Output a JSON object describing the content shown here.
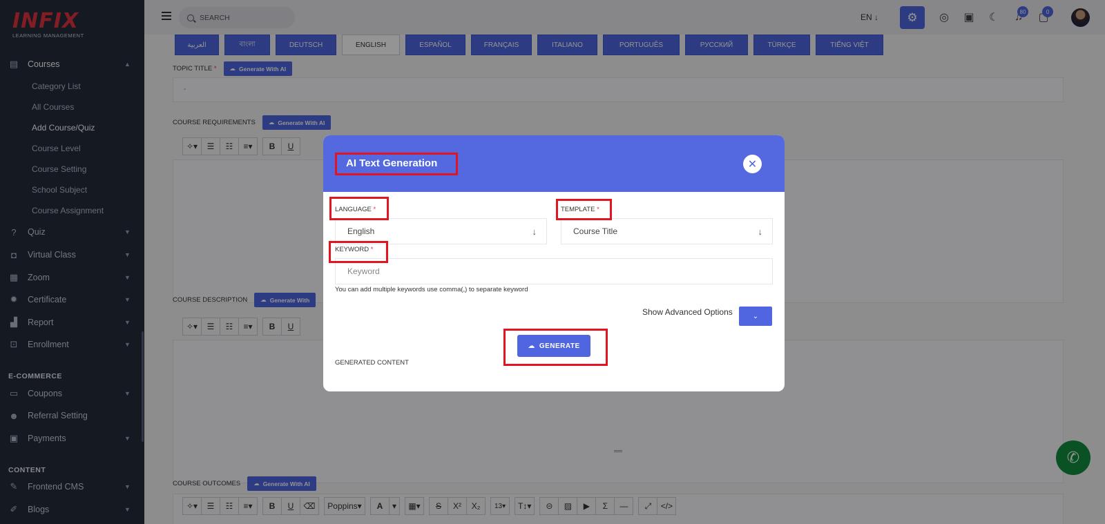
{
  "logo": {
    "brand": "INFIX",
    "tagline": "LEARNING MANAGEMENT"
  },
  "sidebar": {
    "courses": {
      "label": "Courses",
      "subitems": [
        "Category List",
        "All Courses",
        "Add Course/Quiz",
        "Course Level",
        "Course Setting",
        "School Subject",
        "Course Assignment"
      ],
      "active_sub": "Add Course/Quiz"
    },
    "items": [
      {
        "label": "Quiz",
        "icon": "question-icon"
      },
      {
        "label": "Virtual Class",
        "icon": "vr-icon"
      },
      {
        "label": "Zoom",
        "icon": "grid-icon"
      },
      {
        "label": "Certificate",
        "icon": "gear-icon"
      },
      {
        "label": "Report",
        "icon": "chart-icon"
      },
      {
        "label": "Enrollment",
        "icon": "enroll-icon"
      }
    ],
    "ecommerce_heading": "E-COMMERCE",
    "ecommerce_items": [
      {
        "label": "Coupons",
        "icon": "ticket-icon"
      },
      {
        "label": "Referral Setting",
        "icon": "users-icon"
      },
      {
        "label": "Payments",
        "icon": "money-icon"
      }
    ],
    "content_heading": "CONTENT",
    "content_items": [
      {
        "label": "Frontend CMS",
        "icon": "brush-icon"
      },
      {
        "label": "Blogs",
        "icon": "edit-icon"
      }
    ]
  },
  "topbar": {
    "search_placeholder": "SEARCH",
    "language": "EN",
    "notification_count": "80",
    "message_count": "0"
  },
  "language_tabs": [
    "العربية",
    "বাংলা",
    "DEUTSCH",
    "ENGLISH",
    "ESPAÑOL",
    "FRANÇAIS",
    "ITALIANO",
    "PORTUGUÊS",
    "РУССКИЙ",
    "TÜRKÇE",
    "TIẾNG VIỆT"
  ],
  "active_language_tab": "ENGLISH",
  "form": {
    "topic_title_label": "TOPIC TITLE",
    "topic_title_value": "-",
    "requirements_label": "COURSE REQUIREMENTS",
    "description_label": "COURSE DESCRIPTION",
    "outcomes_label": "COURSE OUTCOMES",
    "ai_button": "Generate With AI",
    "ai_button_truncated": "Generate With",
    "required_mark": "*"
  },
  "editor_toolbar": {
    "font": "Poppins",
    "font_size": "13"
  },
  "modal": {
    "title": "AI Text Generation",
    "language_label": "LANGUAGE",
    "language_value": "English",
    "template_label": "TEMPLATE",
    "template_value": "Course Title",
    "keyword_label": "KEYWORD",
    "keyword_placeholder": "Keyword",
    "hint": "You can add multiple keywords use comma(,) to separate keyword",
    "advanced_label": "Show Advanced Options",
    "generate_label": "GENERATE",
    "generated_content_label": "GENERATED CONTENT",
    "required_mark": "*"
  },
  "colors": {
    "accent": "#4f66e0",
    "sidebar": "#232b3c",
    "highlight": "#e2141f",
    "whatsapp": "#128c3e"
  }
}
